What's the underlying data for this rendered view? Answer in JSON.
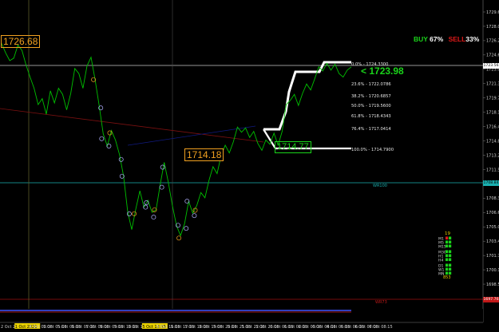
{
  "colors": {
    "background": "#000000",
    "price_line": "#00c000",
    "bid_line": "#c8c8c8",
    "orange_label": "#f0a020",
    "green_label": "#1ad41a",
    "red_label": "#e01818",
    "cyan_line": "#1ab0b0",
    "red_level": "#9a1010",
    "trend_red": "#7a1010",
    "trend_blue": "#101a80",
    "channel": "#ffffff",
    "axis_tick": "#cfcfcf"
  },
  "labels": {
    "high_price": "1726.68",
    "mid_price": "1714.18",
    "low_price": "1714.77",
    "current_price": "< 1723.98",
    "buy": "BUY",
    "buy_pct": "67%",
    "sell": "SELL",
    "sell_pct": "33%",
    "cyan_line_label": "WR100",
    "red_line_label": "WR73",
    "bid_tag": "1723.56",
    "cyan_tag": "1708.84",
    "red_tag": "1697.76"
  },
  "fib_levels": [
    {
      "pct": "0.0%",
      "val": "1724.3300"
    },
    {
      "pct": "23.6%",
      "val": "1722.0786"
    },
    {
      "pct": "38.2%",
      "val": "1720.6857"
    },
    {
      "pct": "50.0%",
      "val": "1719.5600"
    },
    {
      "pct": "61.8%",
      "val": "1718.4343"
    },
    {
      "pct": "76.4%",
      "val": "1717.0414"
    },
    {
      "pct": "100.0%",
      "val": "1714.7900"
    }
  ],
  "price_axis": {
    "ylim": [
      1696.0,
      1731.0
    ],
    "ticks": [
      "1729.60",
      "1728.00",
      "1726.25",
      "1724.65",
      "1723.00",
      "1721.35",
      "1719.75",
      "1718.10",
      "1716.45",
      "1714.85",
      "1713.20",
      "1711.55",
      "1709.95",
      "1708.30",
      "1706.65",
      "1705.05",
      "1703.40",
      "1701.75",
      "1700.15",
      "1698.50",
      "1696.85"
    ]
  },
  "time_axis": {
    "labels": [
      "2 Oct 2021",
      "1 Oct 2021",
      "4 Oct 02:15",
      "5 Oct 05:15",
      "5 Oct 06:15",
      "5 Oct 07:15",
      "5 Oct 08:15",
      "5 Oct 09:15",
      "5 Oct 10:15",
      "5 Oct 11:15",
      "5 Oct 12:15",
      "5 Oct 16:15",
      "5 Oct 17:15",
      "5 Oct 18:15",
      "5 Oct 19:15",
      "5 Oct 20:15",
      "5 Oct 21:15",
      "5 Oct 22:15",
      "5 Oct 23:15",
      "6 Oct 01:15",
      "6 Oct 02:15",
      "6 Oct 03:15",
      "6 Oct 04:15",
      "6 Oct 05:15",
      "6 Oct 06:15",
      "6 Oct 07:15",
      "6 Oct 08:15"
    ],
    "highlight_indices": [
      1,
      10
    ]
  },
  "timeframes": [
    {
      "label": "M1",
      "state": "sell"
    },
    {
      "label": "M5",
      "state": "buy"
    },
    {
      "label": "M15",
      "state": "buy"
    },
    {
      "label": "M30",
      "state": "buy"
    },
    {
      "label": "H1",
      "state": "buy"
    },
    {
      "label": "H4",
      "state": "buy"
    },
    {
      "label": "D1",
      "state": "buy"
    },
    {
      "label": "W1",
      "state": "buy"
    },
    {
      "label": "MN",
      "state": "buy"
    }
  ],
  "timeframe_header": "19",
  "timeframe_footer": "853",
  "chart_data": {
    "type": "line",
    "ylim": [
      1696.0,
      1731.0
    ],
    "series": [
      {
        "values": [
          1726.7,
          1725.6,
          1724.7,
          1725.0,
          1726.5,
          1725.9,
          1724.2,
          1722.8,
          1721.5,
          1719.6,
          1720.3,
          1718.5,
          1721.2,
          1719.8,
          1721.5,
          1720.8,
          1719.0,
          1720.9,
          1723.8,
          1723.2,
          1721.5,
          1724.1,
          1725.1,
          1722.5,
          1719.5,
          1716.2,
          1714.8,
          1716.6,
          1715.5,
          1713.8,
          1711.3,
          1707.2,
          1705.1,
          1707.5,
          1709.6,
          1707.7,
          1708.5,
          1707.1,
          1707.4,
          1710.3,
          1712.9,
          1710.6,
          1707.9,
          1705.6,
          1704.4,
          1705.8,
          1708.4,
          1707.0,
          1707.9,
          1709.4,
          1708.8,
          1710.8,
          1712.4,
          1711.6,
          1713.7,
          1714.9,
          1714.0,
          1715.3,
          1717.0,
          1716.4,
          1716.9,
          1715.8,
          1716.5,
          1715.1,
          1714.3,
          1715.5,
          1715.0,
          1716.3,
          1714.9,
          1716.5,
          1719.6,
          1720.1,
          1720.8,
          1719.5,
          1720.9,
          1722.0,
          1721.3,
          1722.6,
          1724.0,
          1723.5,
          1724.4,
          1723.6,
          1724.3,
          1723.2,
          1722.8,
          1723.6,
          1723.98
        ]
      }
    ]
  }
}
